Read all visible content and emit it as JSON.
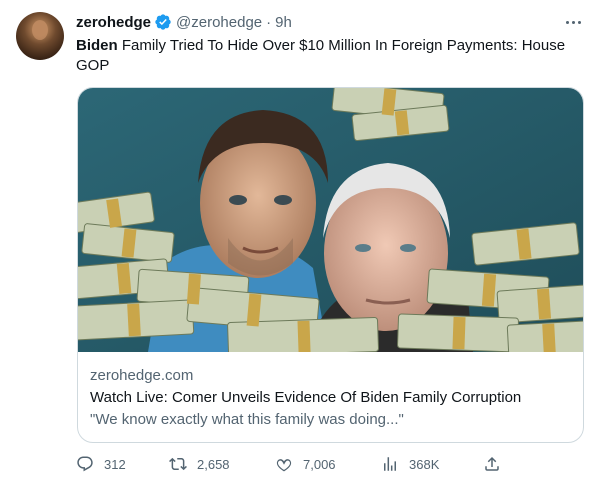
{
  "tweet": {
    "display_name": "zerohedge",
    "handle": "@zerohedge",
    "separator": "·",
    "time": "9h",
    "text_bold": "Biden",
    "text_rest": " Family Tried To Hide Over $10 Million In Foreign Payments: House GOP"
  },
  "card": {
    "domain": "zerohedge.com",
    "title": "Watch Live: Comer Unveils Evidence Of Biden Family Corruption",
    "description": "\"We know exactly what this family was doing...\""
  },
  "actions": {
    "replies": "312",
    "retweets": "2,658",
    "likes": "7,006",
    "views": "368K"
  },
  "icons": {
    "verified": "verified-badge-icon",
    "more": "more-horizontal-icon",
    "reply": "reply-icon",
    "retweet": "retweet-icon",
    "like": "heart-icon",
    "views": "bar-chart-icon",
    "share": "share-icon"
  },
  "colors": {
    "verified_blue": "#1d9bf0",
    "secondary_text": "#536471",
    "primary_text": "#0f1419",
    "border": "#cfd9de"
  }
}
